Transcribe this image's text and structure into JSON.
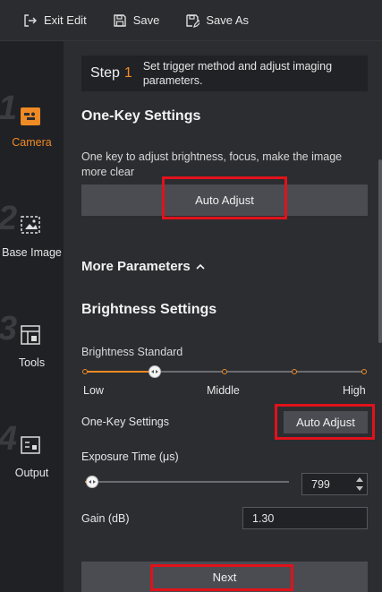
{
  "toolbar": {
    "exit_edit": "Exit Edit",
    "save": "Save",
    "save_as": "Save As"
  },
  "nav": [
    {
      "num": "1",
      "label": "Camera",
      "icon": "camera-icon",
      "active": true
    },
    {
      "num": "2",
      "label": "Base Image",
      "icon": "base-image-icon",
      "active": false
    },
    {
      "num": "3",
      "label": "Tools",
      "icon": "tools-icon",
      "active": false
    },
    {
      "num": "4",
      "label": "Output",
      "icon": "output-icon",
      "active": false
    }
  ],
  "step": {
    "word": "Step",
    "number": "1",
    "description": "Set trigger method and adjust imaging parameters."
  },
  "one_key": {
    "title": "One-Key Settings",
    "description": "One key to adjust brightness, focus, make the image more clear",
    "button": "Auto Adjust"
  },
  "more_parameters": "More Parameters",
  "brightness": {
    "title": "Brightness Settings",
    "standard_label": "Brightness Standard",
    "level_low": "Low",
    "level_middle": "Middle",
    "level_high": "High",
    "slider_fraction": 0.25,
    "one_key_label": "One-Key Settings",
    "one_key_button": "Auto Adjust",
    "exposure_label": "Exposure Time (μs)",
    "exposure_value": "799",
    "gain_label": "Gain (dB)",
    "gain_value": "1.30"
  },
  "next_button": "Next",
  "colors": {
    "accent": "#f08a24",
    "highlight_box": "#e0121b",
    "panel": "#2b2d31",
    "sidebar": "#1f2125"
  }
}
